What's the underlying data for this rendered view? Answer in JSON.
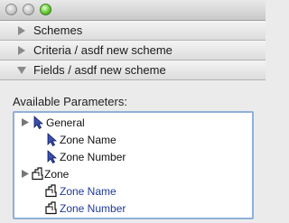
{
  "window": {
    "buttons": [
      "close",
      "minimize",
      "zoom"
    ]
  },
  "sections": [
    {
      "label": "Schemes",
      "expanded": false
    },
    {
      "label": "Criteria / asdf new scheme",
      "expanded": false
    },
    {
      "label": "Fields / asdf new scheme",
      "expanded": true
    }
  ],
  "available_parameters": {
    "label": "Available Parameters:",
    "tree": [
      {
        "label": "General",
        "icon": "cursor-arrow-icon",
        "expandable": true,
        "level": 0
      },
      {
        "label": "Zone Name",
        "icon": "cursor-arrow-icon",
        "expandable": false,
        "level": 1
      },
      {
        "label": "Zone Number",
        "icon": "cursor-arrow-icon",
        "expandable": false,
        "level": 1
      },
      {
        "label": "Zone",
        "icon": "zone-stamp-icon",
        "expandable": true,
        "level": 0
      },
      {
        "label": "Zone Name",
        "icon": "zone-stamp-icon",
        "expandable": false,
        "level": 1,
        "color": "#1f3b9a"
      },
      {
        "label": "Zone Number",
        "icon": "zone-stamp-icon",
        "expandable": false,
        "level": 1,
        "color": "#1f3b9a"
      }
    ]
  },
  "colors": {
    "selection_border": "#8fb0d8",
    "zone_item_text": "#1f3b9a"
  }
}
